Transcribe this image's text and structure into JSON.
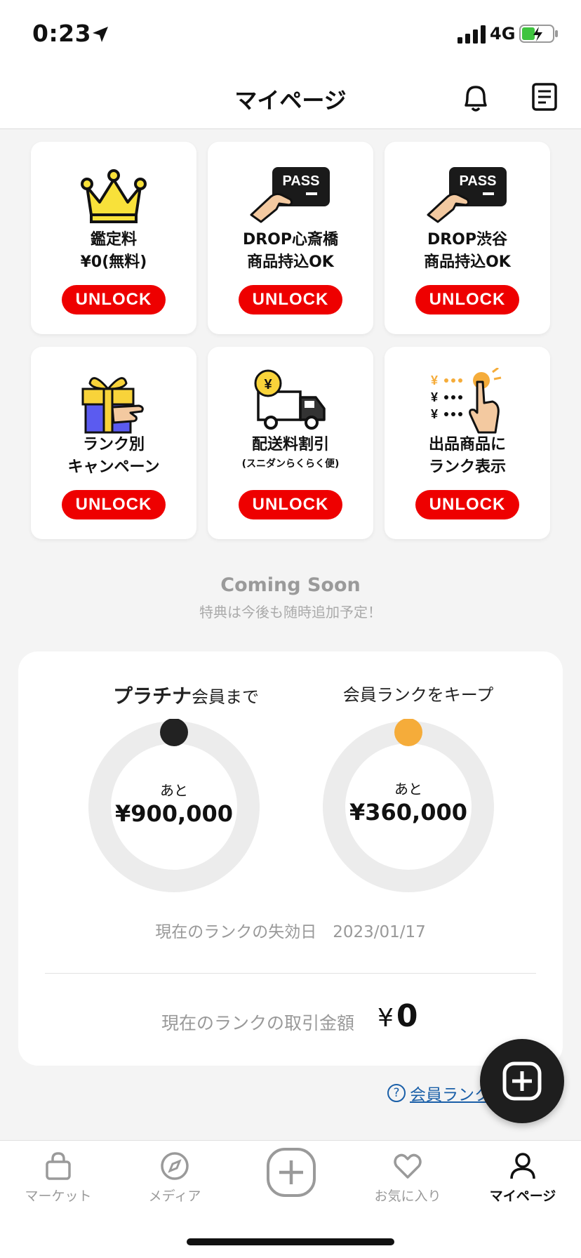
{
  "status_bar": {
    "time": "0:23",
    "network": "4G",
    "icons": [
      "location-arrow-icon",
      "signal-icon",
      "battery-charging-icon"
    ]
  },
  "header": {
    "title": "マイページ",
    "icons": [
      "bell-icon",
      "document-icon"
    ]
  },
  "benefit_cards": [
    {
      "icon": "crown-icon",
      "title_lines": [
        "鑑定料",
        "¥0(無料)"
      ],
      "button": "UNLOCK"
    },
    {
      "icon": "pass-card-icon",
      "badge": "PASS",
      "title_lines": [
        "DROP心斎橋",
        "商品持込OK"
      ],
      "button": "UNLOCK"
    },
    {
      "icon": "pass-card-icon",
      "badge": "PASS",
      "title_lines": [
        "DROP渋谷",
        "商品持込OK"
      ],
      "button": "UNLOCK"
    },
    {
      "icon": "gift-icon",
      "title_lines": [
        "ランク別",
        "キャンペーン"
      ],
      "button": "UNLOCK"
    },
    {
      "icon": "truck-icon",
      "badge": "¥",
      "title_lines": [
        "配送料割引"
      ],
      "subtitle": "(スニダンらくらく便)",
      "button": "UNLOCK"
    },
    {
      "icon": "price-tap-icon",
      "badge": "¥",
      "title_lines": [
        "出品商品に",
        "ランク表示"
      ],
      "button": "UNLOCK"
    }
  ],
  "coming_soon": {
    "title": "Coming Soon",
    "subtitle": "特典は今後も随時追加予定！"
  },
  "rank": {
    "left": {
      "label_bold": "プラチナ",
      "label_rest": "会員まで",
      "remaining_prefix": "あと",
      "remaining_amount": "¥900,000",
      "progress": 0.0,
      "color": "#222222"
    },
    "right": {
      "label": "会員ランクをキープ",
      "remaining_prefix": "あと",
      "remaining_amount": "¥360,000",
      "progress": 0.0,
      "color": "#f5ac3a"
    },
    "expiry_label": "現在のランクの失効日",
    "expiry_date": "2023/01/17",
    "txn_label": "現在のランクの取引金額",
    "txn_currency": "¥",
    "txn_amount": "0"
  },
  "help_link": {
    "text": "会員ランク",
    "icon": "question-circle-icon"
  },
  "fab": {
    "icon": "plus-circle-icon"
  },
  "tabs": [
    {
      "label": "マーケット",
      "icon": "shopping-bag-icon",
      "active": false
    },
    {
      "label": "メディア",
      "icon": "compass-icon",
      "active": false
    },
    {
      "label": "",
      "icon": "plus-circle-icon",
      "active": false
    },
    {
      "label": "お気に入り",
      "icon": "heart-icon",
      "active": false
    },
    {
      "label": "マイページ",
      "icon": "person-icon",
      "active": true
    }
  ],
  "colors": {
    "unlock_red": "#ee0000",
    "accent_orange": "#f5ac3a",
    "link_blue": "#1a5fa8"
  }
}
